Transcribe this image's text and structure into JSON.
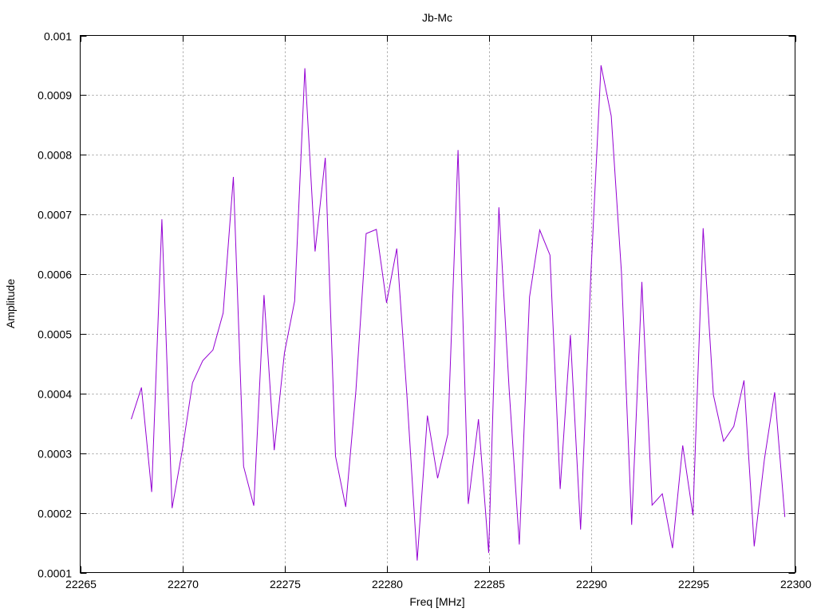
{
  "chart_data": {
    "type": "line",
    "title": "Jb-Mc",
    "xlabel": "Freq [MHz]",
    "ylabel": "Amplitude",
    "xlim": [
      22265,
      22300
    ],
    "ylim": [
      0.0001,
      0.001
    ],
    "xticks": [
      "22265",
      "22270",
      "22275",
      "22280",
      "22285",
      "22290",
      "22295",
      "22300"
    ],
    "yticks": [
      "0.0001",
      "0.0002",
      "0.0003",
      "0.0004",
      "0.0005",
      "0.0006",
      "0.0007",
      "0.0008",
      "0.0009",
      "0.001"
    ],
    "grid": true,
    "series": [
      {
        "color": "#9400d3",
        "x": [
          22267.5,
          22268.0,
          22268.5,
          22269.0,
          22269.5,
          22270.0,
          22270.5,
          22271.0,
          22271.5,
          22272.0,
          22272.5,
          22273.0,
          22273.5,
          22274.0,
          22274.5,
          22275.0,
          22275.5,
          22276.0,
          22276.5,
          22277.0,
          22277.5,
          22278.0,
          22278.5,
          22279.0,
          22279.5,
          22280.0,
          22280.5,
          22281.0,
          22281.5,
          22282.0,
          22282.5,
          22283.0,
          22283.5,
          22284.0,
          22284.5,
          22285.0,
          22285.5,
          22286.0,
          22286.5,
          22287.0,
          22287.5,
          22288.0,
          22288.5,
          22289.0,
          22289.5,
          22290.0,
          22290.5,
          22291.0,
          22291.5,
          22292.0,
          22292.5,
          22293.0,
          22293.5,
          22294.0,
          22294.5,
          22295.0,
          22295.5,
          22296.0,
          22296.5,
          22297.0,
          22297.5,
          22298.0,
          22298.5,
          22299.0,
          22299.5
        ],
        "y": [
          0.000357,
          0.00041,
          0.000235,
          0.000692,
          0.000208,
          0.000305,
          0.000418,
          0.000455,
          0.000473,
          0.000535,
          0.000763,
          0.000278,
          0.000212,
          0.000565,
          0.000305,
          0.000468,
          0.000555,
          0.000945,
          0.000638,
          0.000795,
          0.000295,
          0.00021,
          0.000405,
          0.000668,
          0.000675,
          0.000552,
          0.000643,
          0.000395,
          0.00012,
          0.000363,
          0.000258,
          0.000332,
          0.000808,
          0.000215,
          0.000357,
          0.000133,
          0.000712,
          0.000408,
          0.000147,
          0.000562,
          0.000674,
          0.000632,
          0.00024,
          0.000498,
          0.000172,
          0.000597,
          0.00095,
          0.000865,
          0.000603,
          0.00018,
          0.000587,
          0.000213,
          0.000232,
          0.000141,
          0.000313,
          0.000196,
          0.000677,
          0.000398,
          0.00032,
          0.000345,
          0.000422,
          0.000144,
          0.00029,
          0.000402,
          0.000193
        ]
      }
    ]
  }
}
